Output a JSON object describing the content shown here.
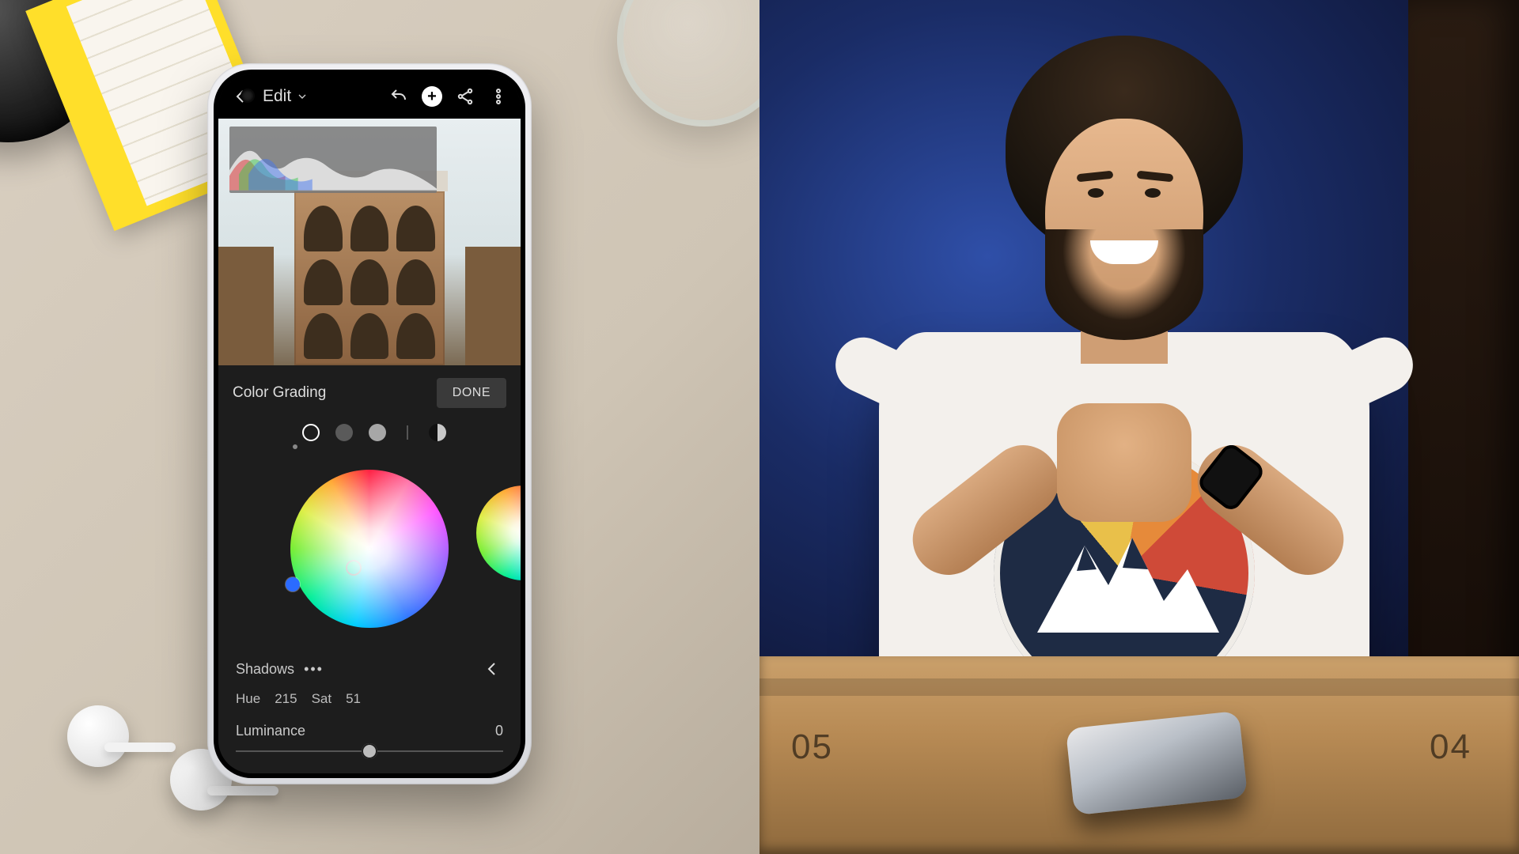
{
  "appbar": {
    "title": "Edit",
    "icons": {
      "back": "back-arrow",
      "undo": "undo",
      "add": "plus",
      "share": "share",
      "more": "more-vert"
    }
  },
  "panel": {
    "title": "Color Grading",
    "done_label": "DONE",
    "ranges": [
      "shadows",
      "midtones",
      "highlights",
      "global"
    ],
    "active_range_index": 0,
    "section_label": "Shadows",
    "hue_label": "Hue",
    "hue_value": "215",
    "sat_label": "Sat",
    "sat_value": "51",
    "luminance_label": "Luminance",
    "luminance_value": "0",
    "luminance_slider_percent": 50
  },
  "desk": {
    "left_number": "05",
    "right_number": "04"
  }
}
